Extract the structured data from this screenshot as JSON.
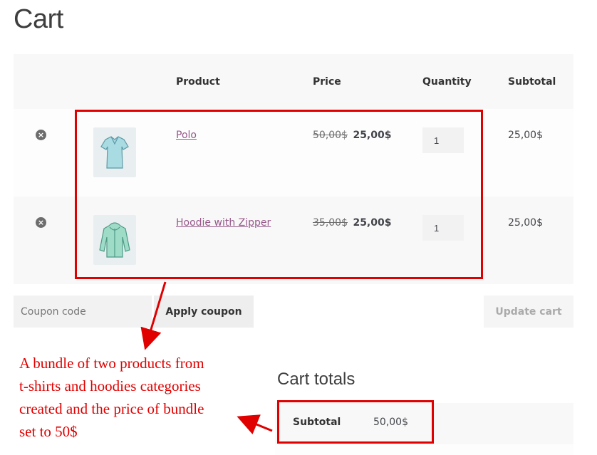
{
  "page": {
    "title": "Cart"
  },
  "table": {
    "headers": {
      "product": "Product",
      "price": "Price",
      "quantity": "Quantity",
      "subtotal": "Subtotal"
    },
    "items": [
      {
        "name": "Polo",
        "old_price": "50,00$",
        "price": "25,00$",
        "quantity": "1",
        "subtotal": "25,00$",
        "remove": "×",
        "thumb_icon": "polo-shirt-icon"
      },
      {
        "name": "Hoodie with Zipper",
        "old_price": "35,00$",
        "price": "25,00$",
        "quantity": "1",
        "subtotal": "25,00$",
        "remove": "×",
        "thumb_icon": "hoodie-icon"
      }
    ]
  },
  "actions": {
    "coupon_placeholder": "Coupon code",
    "apply_coupon": "Apply coupon",
    "update_cart": "Update cart"
  },
  "totals": {
    "title": "Cart totals",
    "subtotal_label": "Subtotal",
    "subtotal_value": "50,00$"
  },
  "annotation": {
    "text": "A bundle of two products from\nt-shirts and hoodies categories\ncreated and the price of bundle\nset to 50$",
    "color": "#e00000"
  },
  "colors": {
    "link": "#96588a",
    "accent": "#e00000"
  }
}
